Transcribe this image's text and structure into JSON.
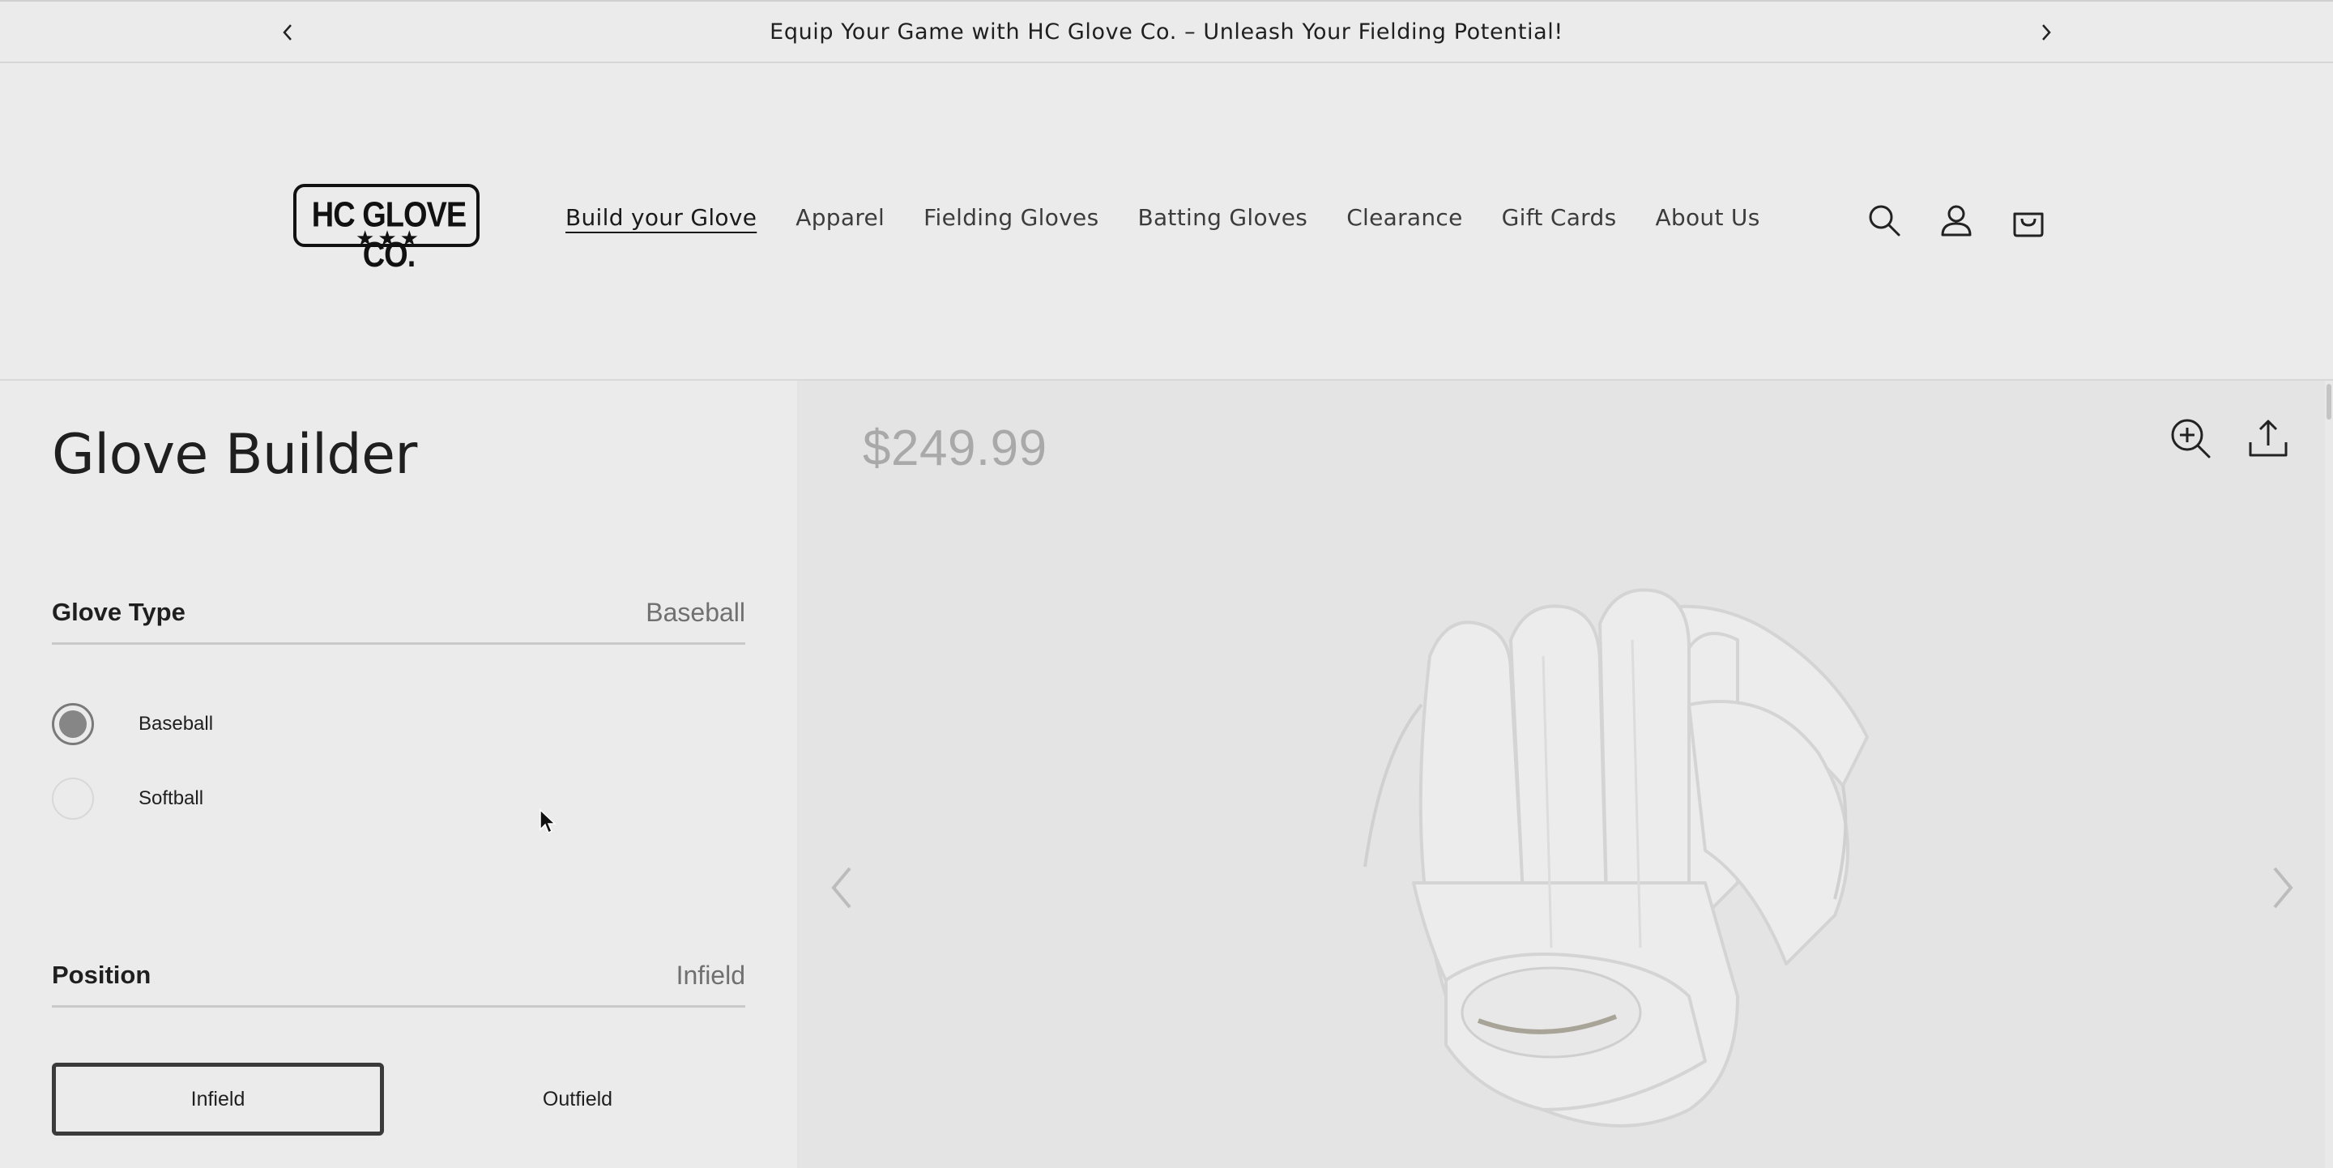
{
  "announcement": {
    "text": "Equip Your Game with HC Glove Co. – Unleash Your Fielding Potential!",
    "prev_icon": "chevron-left-icon",
    "next_icon": "chevron-right-icon"
  },
  "header": {
    "logo_text": "HC GLOVE CO.",
    "logo_stars": "★★★",
    "nav": [
      {
        "label": "Build your Glove",
        "active": true
      },
      {
        "label": "Apparel"
      },
      {
        "label": "Fielding Gloves"
      },
      {
        "label": "Batting Gloves"
      },
      {
        "label": "Clearance"
      },
      {
        "label": "Gift Cards"
      },
      {
        "label": "About Us"
      }
    ],
    "icons": [
      "search-icon",
      "account-icon",
      "cart-icon"
    ]
  },
  "builder": {
    "title": "Glove Builder",
    "glove_type": {
      "label": "Glove Type",
      "value": "Baseball",
      "options": [
        {
          "label": "Baseball",
          "checked": true
        },
        {
          "label": "Softball",
          "checked": false
        }
      ]
    },
    "position": {
      "label": "Position",
      "value": "Infield",
      "options": [
        {
          "label": "Infield",
          "selected": true
        },
        {
          "label": "Outfield",
          "selected": false
        }
      ]
    }
  },
  "preview": {
    "price": "$249.99",
    "tools": [
      "zoom-in-icon",
      "share-icon"
    ],
    "nav_icons": [
      "chevron-left-icon",
      "chevron-right-icon"
    ],
    "image": "glove-image"
  },
  "colors": {
    "background": "#ebebeb",
    "preview_bg": "#e4e4e4",
    "text": "#1f1f1f",
    "muted": "#707070",
    "price": "#a9a9a9"
  }
}
